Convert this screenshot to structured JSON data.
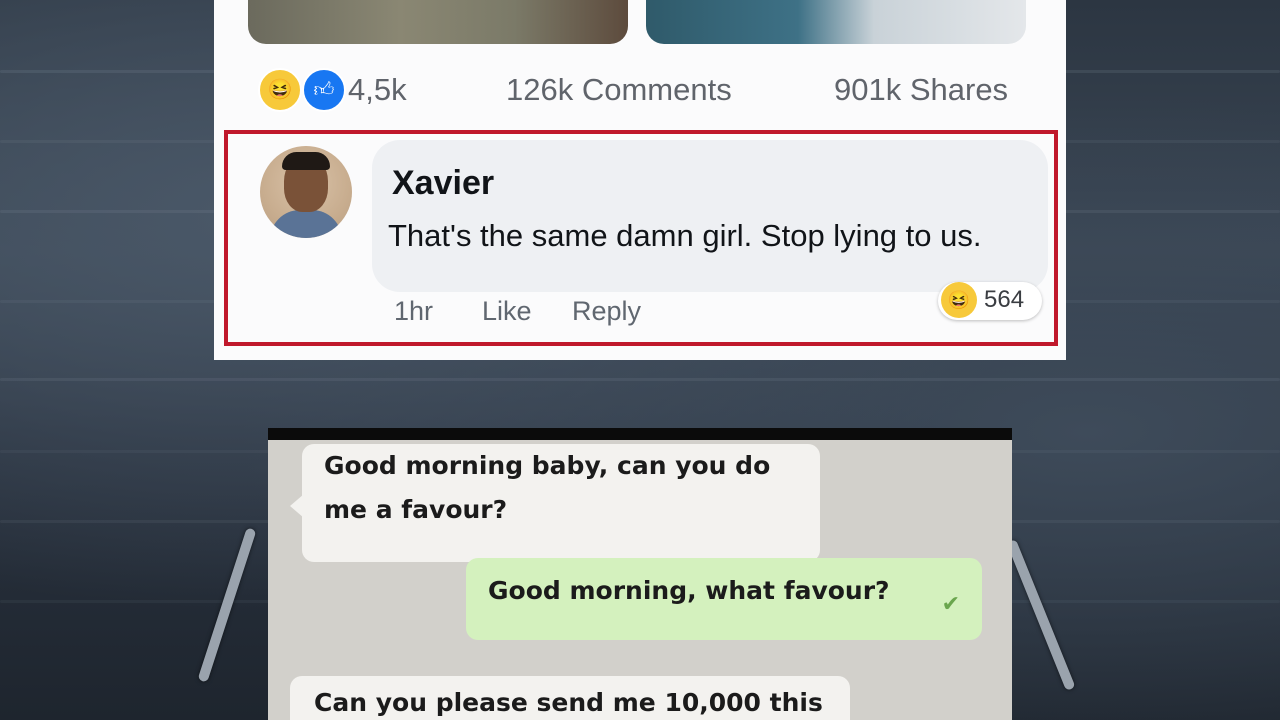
{
  "post": {
    "stats": {
      "reactions_count": "4,5k",
      "comments": "126k Comments",
      "shares": "901k Shares",
      "reaction_icons": [
        "haha-emoji",
        "like-thumb"
      ]
    },
    "comment": {
      "author": "Xavier",
      "text": "That's the same damn girl. Stop lying to us.",
      "time": "1hr",
      "like_label": "Like",
      "reply_label": "Reply",
      "reaction_count": "564",
      "highlight_color": "#c0182c"
    }
  },
  "chat": {
    "messages": [
      {
        "direction": "incoming",
        "lines": [
          "Good  morning baby, can you do",
          "me a favour?"
        ]
      },
      {
        "direction": "outgoing",
        "text": "Good morning, what favour?"
      },
      {
        "direction": "incoming",
        "text": "Can you please send me 10,000 this"
      }
    ]
  },
  "colors": {
    "facebook_blue": "#1877f2",
    "outgoing_bubble": "#d4f1be",
    "incoming_bubble": "#f3f2ef"
  }
}
